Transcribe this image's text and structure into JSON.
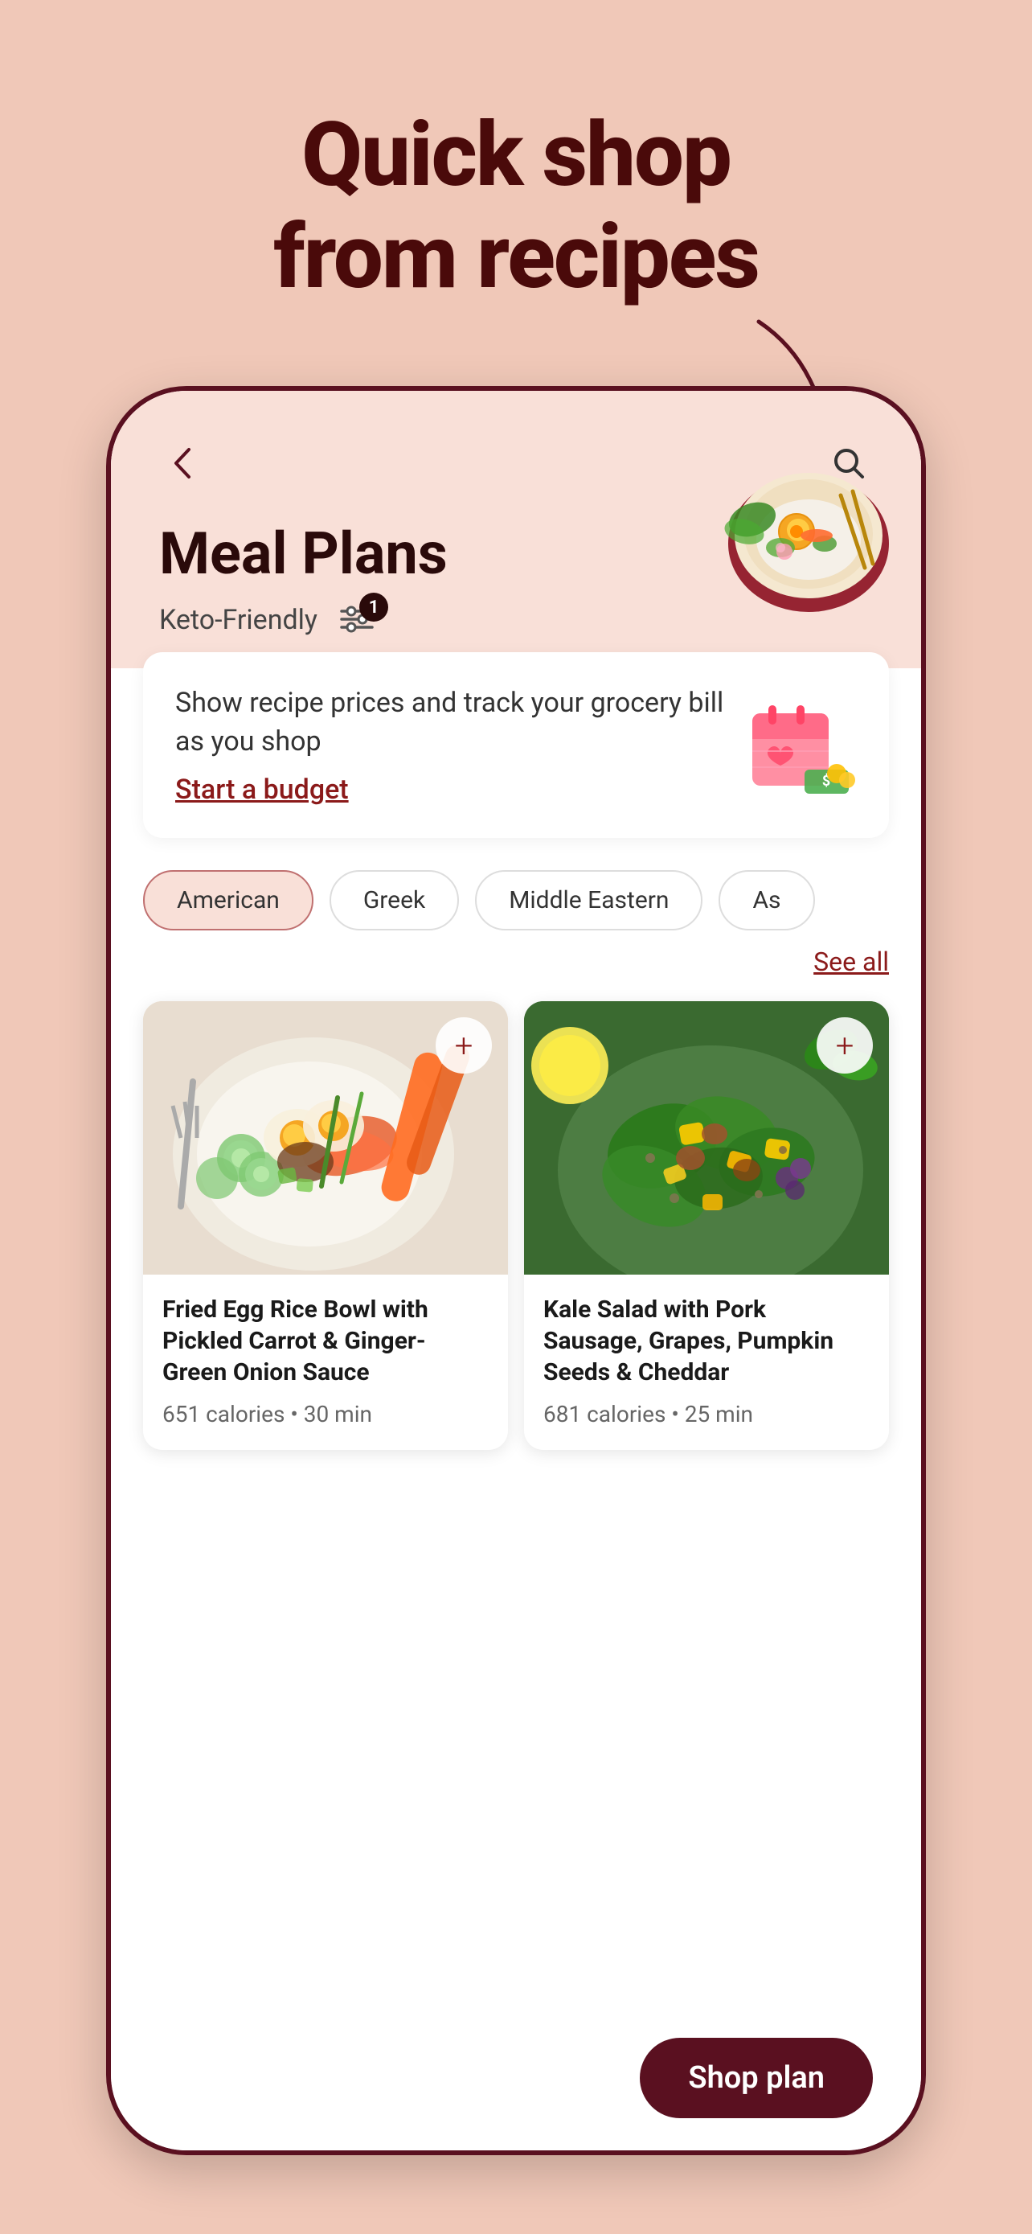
{
  "page": {
    "bg_color": "#f0c8b8",
    "hero_title": "Quick shop\nfrom recipes"
  },
  "nav": {
    "back_label": "←",
    "search_label": "🔍"
  },
  "header": {
    "title": "Meal Plans",
    "filter_label": "Keto-Friendly",
    "badge_count": "1"
  },
  "budget_banner": {
    "description": "Show recipe prices and track your grocery bill as you shop",
    "link_label": "Start a budget"
  },
  "categories": [
    {
      "label": "American",
      "active": true
    },
    {
      "label": "Greek",
      "active": false
    },
    {
      "label": "Middle Eastern",
      "active": false
    },
    {
      "label": "As",
      "active": false
    }
  ],
  "see_all_label": "See all",
  "recipes": [
    {
      "id": "recipe-1",
      "title": "Fried Egg Rice Bowl with Pickled Carrot & Ginger-Green Onion Sauce",
      "calories": "651 calories",
      "time": "30 min",
      "meta": "651 calories • 30 min"
    },
    {
      "id": "recipe-2",
      "title": "Kale Salad with Pork Sausage, Grapes, Pumpkin Seeds & Cheddar",
      "calories": "681 calories",
      "time": "25 min",
      "meta": "681 calories • 25 min"
    }
  ],
  "shop_btn_label": "Shop plan",
  "add_btn_label": "+"
}
